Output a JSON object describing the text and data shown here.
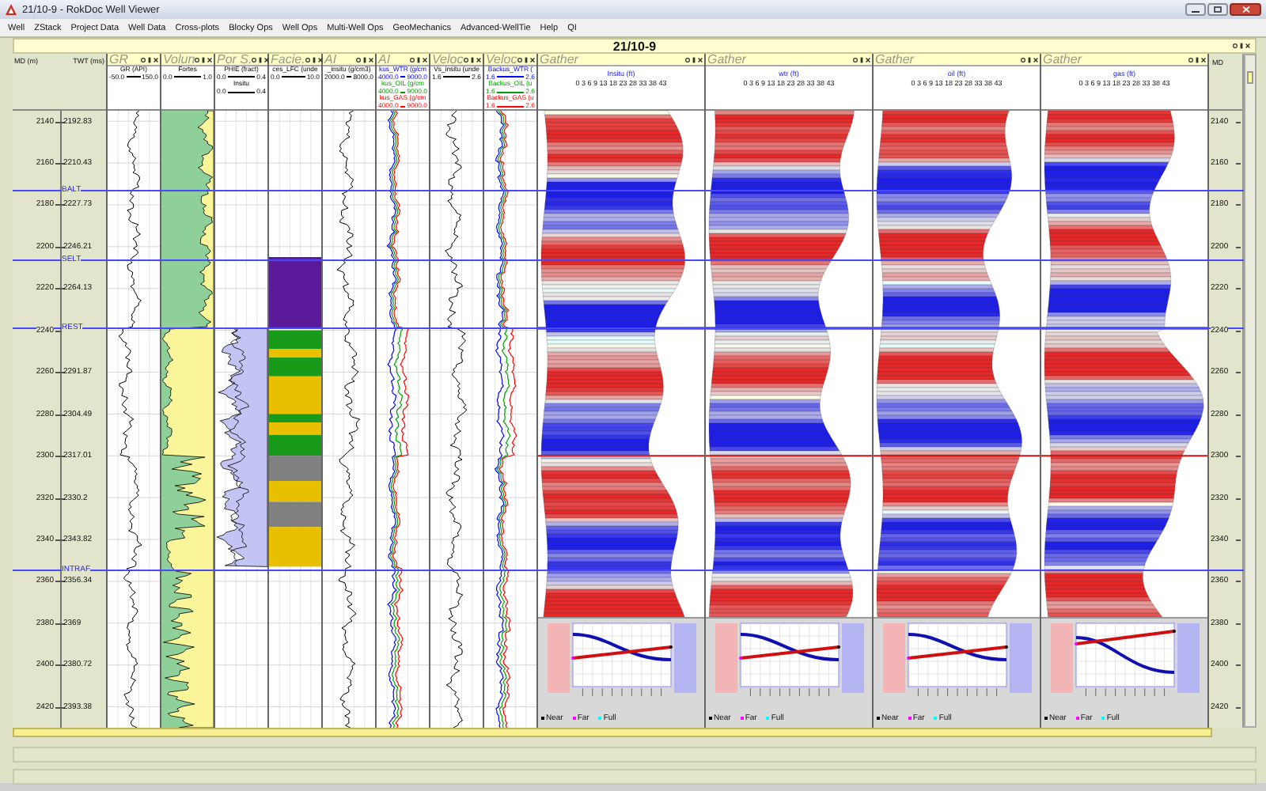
{
  "window": {
    "title": "21/10-9 - RokDoc Well Viewer"
  },
  "menu": [
    "Well",
    "ZStack",
    "Project Data",
    "Well Data",
    "Cross-plots",
    "Blocky Ops",
    "Well Ops",
    "Multi-Well Ops",
    "GeoMechanics",
    "Advanced-WellTie",
    "Help",
    "QI"
  ],
  "panel": {
    "title": "21/10-9"
  },
  "depth_axis": {
    "md_label": "MD (m)",
    "twt_label": "TWT (ms)",
    "rows": [
      {
        "md": "2140",
        "twt": "2192.83"
      },
      {
        "md": "2160",
        "twt": "2210.43"
      },
      {
        "md": "2180",
        "twt": "2227.73"
      },
      {
        "md": "2200",
        "twt": "2246.21"
      },
      {
        "md": "2220",
        "twt": "2264.13"
      },
      {
        "md": "2240"
      },
      {
        "md": "2260",
        "twt": "2291.87"
      },
      {
        "md": "2280",
        "twt": "2304.49"
      },
      {
        "md": "2300",
        "twt": "2317.01"
      },
      {
        "md": "2320",
        "twt": "2330.2"
      },
      {
        "md": "2340",
        "twt": "2343.82"
      },
      {
        "md": "2360",
        "twt": "2356.34"
      },
      {
        "md": "2380",
        "twt": "2369"
      },
      {
        "md": "2400",
        "twt": "2380.72"
      },
      {
        "md": "2420",
        "twt": "2393.38"
      }
    ]
  },
  "horizons": [
    {
      "name": "BALT"
    },
    {
      "name": "SELT"
    },
    {
      "name": "REST"
    },
    {
      "name": "INTRAF"
    }
  ],
  "tracks": [
    {
      "kind": "gr",
      "title": "GR",
      "curves": [
        {
          "name": "GR (API)",
          "min": "-50.0",
          "max": "150.0",
          "color": "#000000"
        }
      ]
    },
    {
      "kind": "volume",
      "title": "Volun",
      "curves": [
        {
          "name": "Fortes",
          "min": "0.0",
          "max": "1.0",
          "color": "#000000"
        }
      ]
    },
    {
      "kind": "porosity",
      "title": "Por S.",
      "curves": [
        {
          "name": "PHIE (fract)",
          "min": "0.0",
          "max": "0.4",
          "color": "#000000"
        },
        {
          "name": "Insitu",
          "min": "0.0",
          "max": "0.4",
          "color": "#000000"
        }
      ]
    },
    {
      "kind": "facies",
      "title": "Facie.",
      "curves": [
        {
          "name": "ces_LFC (unde",
          "min": "0.0",
          "max": "10.0",
          "color": "#000000"
        }
      ]
    },
    {
      "kind": "log",
      "title": "AI",
      "curves": [
        {
          "name": "_insitu (g/cm3)",
          "min": "2000.0",
          "max": "8000.0",
          "color": "#000000"
        }
      ]
    },
    {
      "kind": "fluid",
      "title": "AI",
      "curves": [
        {
          "name": "kus_WTR (g/cm",
          "min": "4000.0",
          "max": "9000.0",
          "color": "#0000ff"
        },
        {
          "name": "kus_OIL (g/cm",
          "min": "4000.0",
          "max": "9000.0",
          "color": "#00a000"
        },
        {
          "name": "kus_GAS (g/cm",
          "min": "4000.0",
          "max": "9000.0",
          "color": "#ff0000"
        }
      ]
    },
    {
      "kind": "log",
      "title": "Veloc",
      "curves": [
        {
          "name": "Vs_insitu (unde",
          "min": "1.6",
          "max": "2.6",
          "color": "#000000"
        }
      ]
    },
    {
      "kind": "fluid",
      "title": "Veloc",
      "curves": [
        {
          "name": "Backus_WTR (",
          "min": "1.6",
          "max": "2.6",
          "color": "#0000ff"
        },
        {
          "name": "Backus_OIL (u",
          "min": "1.6",
          "max": "2.6",
          "color": "#00a000"
        },
        {
          "name": "Backus_GAS (u",
          "min": "1.6",
          "max": "2.6",
          "color": "#ff0000"
        }
      ]
    }
  ],
  "gathers": [
    {
      "title": "Gather",
      "subtitle": "Insitu (ft)",
      "angles": "0 3 6 9 13 18 23 28 33 38 43",
      "legend": [
        {
          "label": "Near",
          "color": "#000000"
        },
        {
          "label": "Far",
          "color": "#ff00ff"
        },
        {
          "label": "Full",
          "color": "#00ffff"
        }
      ]
    },
    {
      "title": "Gather",
      "subtitle": "wtr (ft)",
      "angles": "0 3 6 9 13 18 23 28 33 38 43",
      "legend": [
        {
          "label": "Near",
          "color": "#000000"
        },
        {
          "label": "Far",
          "color": "#ff00ff"
        },
        {
          "label": "Full",
          "color": "#00ffff"
        }
      ]
    },
    {
      "title": "Gather",
      "subtitle": "oil (ft)",
      "angles": "0 3 6 9 13 18 23 28 33 38 43",
      "legend": [
        {
          "label": "Near",
          "color": "#000000"
        },
        {
          "label": "Far",
          "color": "#ff00ff"
        },
        {
          "label": "Full",
          "color": "#00ffff"
        }
      ]
    },
    {
      "title": "Gather",
      "subtitle": "gas (ft)",
      "angles": "0 3 6 9 13 18 23 28 33 38 43",
      "legend": [
        {
          "label": "Near",
          "color": "#000000"
        },
        {
          "label": "Far",
          "color": "#ff00ff"
        },
        {
          "label": "Full",
          "color": "#00ffff"
        }
      ]
    }
  ],
  "right_axis": {
    "title": "MD",
    "labels": [
      "2140",
      "2160",
      "2180",
      "2200",
      "2220",
      "2240",
      "2260",
      "2280",
      "2300",
      "2320",
      "2340",
      "2360",
      "2380",
      "2400",
      "2420"
    ]
  }
}
